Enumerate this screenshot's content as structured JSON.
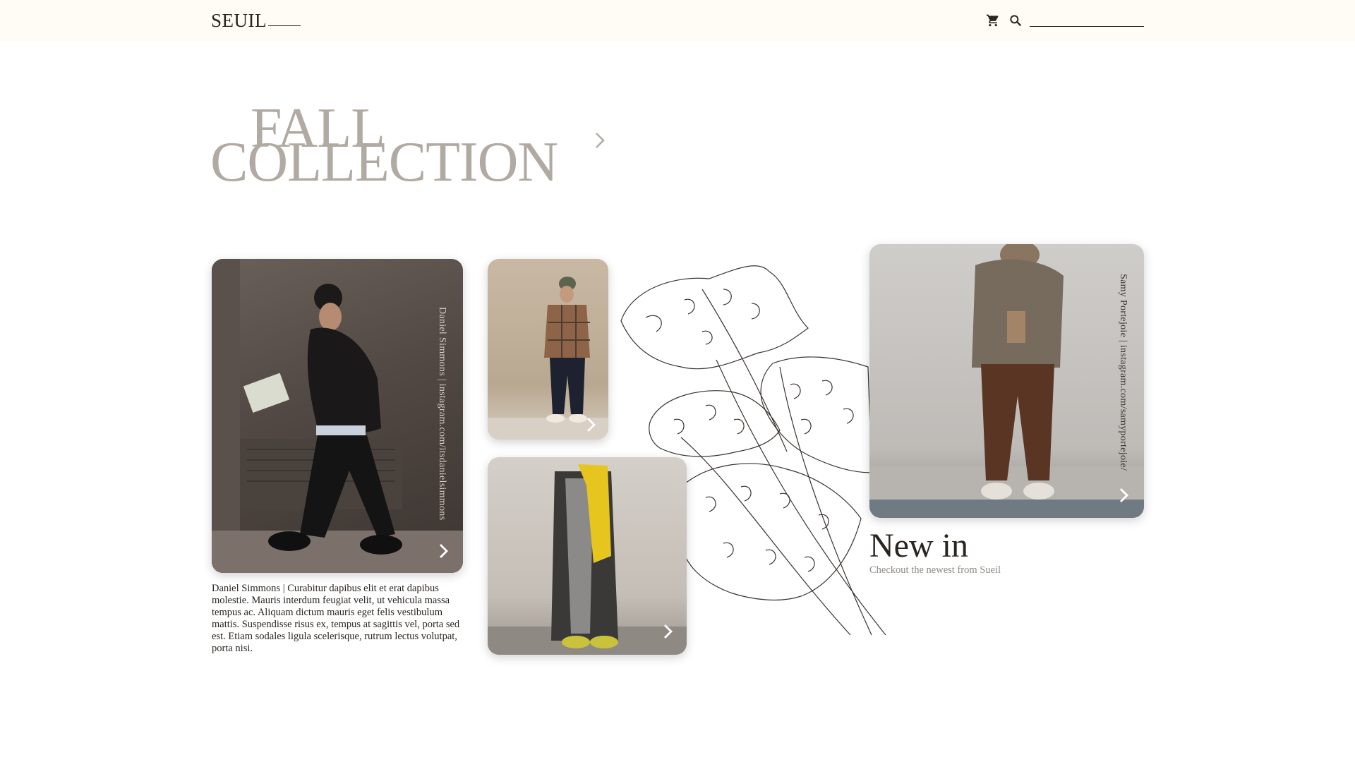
{
  "brand": {
    "name": "SEUIL"
  },
  "header": {
    "cart_icon": "cart-icon",
    "search_icon": "search-icon",
    "search_value": ""
  },
  "hero": {
    "line1": "FALL",
    "line2": "COLLECTION",
    "arrow_icon": "chevron-right-icon"
  },
  "cards": [
    {
      "caption": "Daniel Simmons  |  instagram.com/itsdanielsimmons",
      "arrow_icon": "chevron-right-icon"
    },
    {
      "arrow_icon": "chevron-right-icon"
    },
    {
      "arrow_icon": "chevron-right-icon"
    },
    {
      "caption": "Samy Portejoie  |  instagram.com/samyportejoie/",
      "arrow_icon": "chevron-right-icon"
    }
  ],
  "description": "Daniel Simmons | Curabitur dapibus elit et erat dapibus molestie. Mauris interdum feugiat velit, ut vehicula massa tempus ac. Aliquam dictum mauris eget felis vestibulum mattis. Suspendisse risus ex, tempus at sagittis vel, porta sed est. Etiam sodales ligula scelerisque, rutrum lectus volutpat, porta nisi.",
  "new_in": {
    "title": "New in",
    "subtitle": "Checkout the newest from Sueil"
  },
  "colors": {
    "header_bg": "#fffbf5",
    "hero_text": "#b0aaa3",
    "text": "#2a2520",
    "muted": "#8f8a84"
  }
}
